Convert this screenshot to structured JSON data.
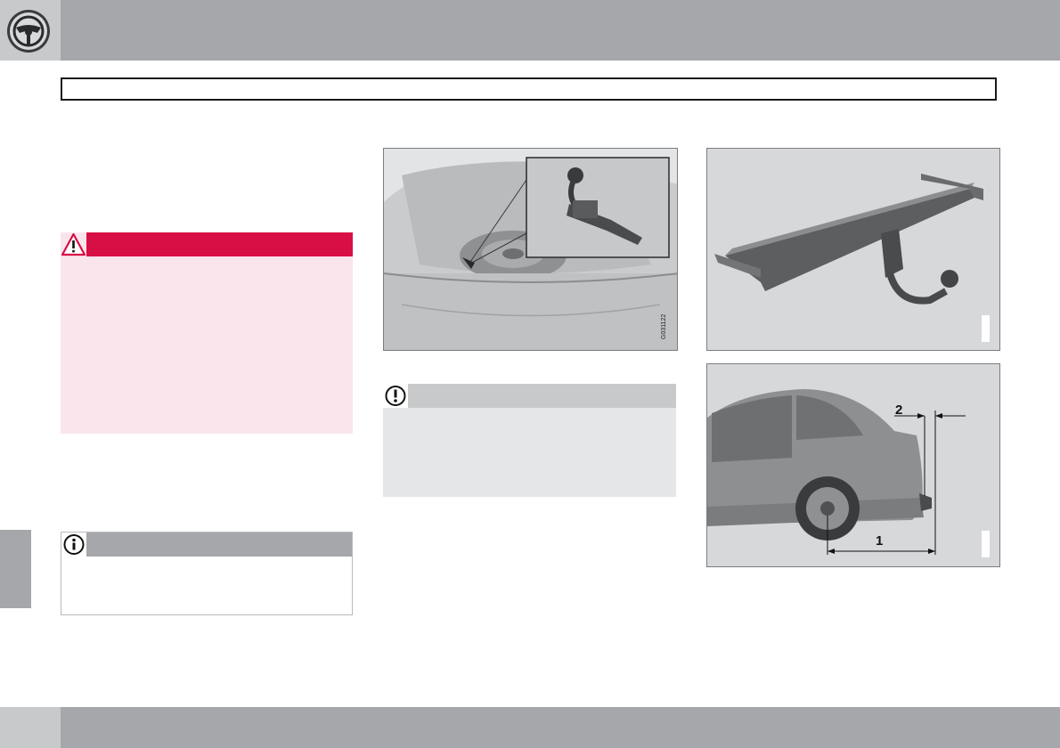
{
  "figures": {
    "trunk": {
      "code": "G031122"
    },
    "rear_dimensions": {
      "labels": [
        "1",
        "2"
      ]
    }
  },
  "icons": {
    "emblem": "steering-wheel-icon",
    "warning": "warning-triangle-icon",
    "important": "exclamation-circle-icon",
    "note": "info-circle-icon"
  },
  "colors": {
    "top_band": "#a5a7aa",
    "warning_bar": "#d80f45",
    "warning_fill": "#fbe5ec",
    "important_fill": "#e5e6e8",
    "note_bar": "#a5a7aa"
  }
}
